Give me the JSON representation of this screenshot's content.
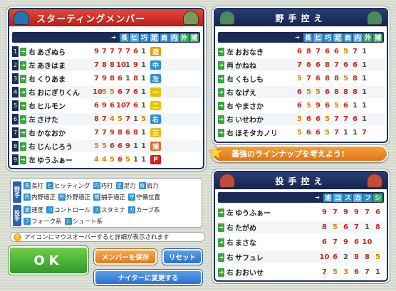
{
  "starting": {
    "title": "スターティングメンバー",
    "columns": [
      "長",
      "ヒ",
      "巧",
      "足",
      "肩",
      "内",
      "外",
      "捕"
    ],
    "rows": [
      {
        "n": "1",
        "hand": "右",
        "name": "あざぬら",
        "stats": [
          "9",
          "7",
          "7",
          "7",
          "7",
          "6",
          "1"
        ],
        "pos": "遊",
        "pc": "#e0a000"
      },
      {
        "n": "2",
        "hand": "左",
        "name": "あきはま",
        "stats": [
          "7",
          "8",
          "8",
          "10",
          "1",
          "9",
          "1"
        ],
        "pos": "中",
        "pc": "#2d8fd0"
      },
      {
        "n": "3",
        "hand": "右",
        "name": "くりあま",
        "stats": [
          "7",
          "9",
          "8",
          "6",
          "1",
          "8",
          "1"
        ],
        "pos": "左",
        "pc": "#2d8fd0"
      },
      {
        "n": "4",
        "hand": "右",
        "name": "おにぎりくん",
        "stats": [
          "10",
          "5",
          "5",
          "6",
          "7",
          "6",
          "1"
        ],
        "pos": "一",
        "pc": "#e8c400"
      },
      {
        "n": "5",
        "hand": "右",
        "name": "ヒルモン",
        "stats": [
          "6",
          "9",
          "6",
          "10",
          "7",
          "6",
          "1"
        ],
        "pos": "二",
        "pc": "#e8c400"
      },
      {
        "n": "6",
        "hand": "左",
        "name": "さけた",
        "stats": [
          "8",
          "7",
          "4",
          "5",
          "7",
          "1",
          "5"
        ],
        "pos": "右",
        "pc": "#2d8fd0"
      },
      {
        "n": "7",
        "hand": "右",
        "name": "かなおか",
        "stats": [
          "7",
          "7",
          "9",
          "8",
          "6",
          "8",
          "1"
        ],
        "pos": "三",
        "pc": "#e8c400"
      },
      {
        "n": "8",
        "hand": "右",
        "name": "じんじろう",
        "stats": [
          "5",
          "5",
          "6",
          "6",
          "9",
          "1",
          "1"
        ],
        "pos": "捕",
        "pc": "#e07020"
      },
      {
        "n": "9",
        "hand": "左",
        "name": "ゆうふぁー",
        "stats": [
          "4",
          "4",
          "5",
          "6",
          "5",
          "1",
          "1"
        ],
        "pos": "P",
        "pc": "#d02020"
      }
    ]
  },
  "bench": {
    "title": "野手控え",
    "columns": [
      "長",
      "ヒ",
      "巧",
      "足",
      "肩",
      "内",
      "外",
      "捕"
    ],
    "rows": [
      {
        "hand": "左",
        "name": "おおなき",
        "stats": [
          "6",
          "8",
          "7",
          "6",
          "6",
          "5",
          "7",
          "1"
        ]
      },
      {
        "hand": "両",
        "name": "かねね",
        "stats": [
          "7",
          "6",
          "6",
          "8",
          "7",
          "6",
          "6",
          "1"
        ]
      },
      {
        "hand": "右",
        "name": "くもしも",
        "stats": [
          "5",
          "7",
          "6",
          "8",
          "8",
          "5",
          "8",
          "1"
        ]
      },
      {
        "hand": "右",
        "name": "なげえ",
        "stats": [
          "6",
          "5",
          "5",
          "6",
          "8",
          "8",
          "8",
          "1"
        ]
      },
      {
        "hand": "右",
        "name": "やまさか",
        "stats": [
          "6",
          "5",
          "9",
          "6",
          "5",
          "6",
          "1",
          "1"
        ]
      },
      {
        "hand": "右",
        "name": "いせわか",
        "stats": [
          "5",
          "6",
          "6",
          "5",
          "7",
          "7",
          "6",
          "1"
        ]
      },
      {
        "hand": "右",
        "name": "ほそタカノリ",
        "stats": [
          "5",
          "6",
          "6",
          "5",
          "7",
          "1",
          "1",
          "7"
        ]
      }
    ]
  },
  "banner": {
    "text": "最強のラインナップを考えよう!"
  },
  "pitchers": {
    "title": "投手控え",
    "columns": [
      "速",
      "コ",
      "ス",
      "カ",
      "フ",
      "シ"
    ],
    "rows": [
      {
        "hand": "左",
        "name": "ゆうふぁー",
        "stats": [
          "9",
          "7",
          "9",
          "9",
          "7",
          "6"
        ]
      },
      {
        "hand": "右",
        "name": "たがめ",
        "stats": [
          "8",
          "5",
          "6",
          "7",
          "1",
          "8"
        ]
      },
      {
        "hand": "右",
        "name": "まさな",
        "stats": [
          "6",
          "7",
          "9",
          "6",
          "10",
          ""
        ]
      },
      {
        "hand": "右",
        "name": "サフュレ",
        "stats": [
          "10",
          "6",
          "2",
          "8",
          "8",
          "5"
        ]
      },
      {
        "hand": "右",
        "name": "おおいせ",
        "stats": [
          "7",
          "5",
          "3",
          "6",
          "7",
          "1"
        ]
      }
    ]
  },
  "legend": {
    "fielder_label": "野手",
    "pitcher_label": "投手",
    "fielder": [
      {
        "k": "長",
        "t": "長打",
        "c": "#2d8fd0"
      },
      {
        "k": "ヒ",
        "t": "ヒッティング",
        "c": "#2d8fd0"
      },
      {
        "k": "巧",
        "t": "巧打",
        "c": "#2d8fd0"
      },
      {
        "k": "足",
        "t": "足力",
        "c": "#2d8fd0"
      },
      {
        "k": "肩",
        "t": "肩力",
        "c": "#2d8fd0"
      },
      {
        "k": "内",
        "t": "内野適正",
        "c": "#2d8fd0"
      },
      {
        "k": "外",
        "t": "外野適正",
        "c": "#2d8fd0"
      },
      {
        "k": "捕",
        "t": "捕手適正",
        "c": "#2d8fd0"
      },
      {
        "k": "守",
        "t": "守備位置",
        "c": "#2d8fd0"
      }
    ],
    "pitcher": [
      {
        "k": "速",
        "t": "速度",
        "c": "#2d8fd0"
      },
      {
        "k": "コ",
        "t": "コントロール",
        "c": "#2d8fd0"
      },
      {
        "k": "ス",
        "t": "スタミナ",
        "c": "#2d8fd0"
      },
      {
        "k": "カ",
        "t": "カーブ系",
        "c": "#2d8fd0"
      },
      {
        "k": "フ",
        "t": "フォーク系",
        "c": "#2d8fd0"
      },
      {
        "k": "シ",
        "t": "シュート系",
        "c": "#2d8fd0"
      }
    ]
  },
  "note": {
    "icon": "!",
    "text": "アイコンにマウスオーバーすると詳細が表示されます"
  },
  "buttons": {
    "ok": "OK",
    "save": "メンバーを保存",
    "reset": "リセット",
    "nighter": "ナイターに変更する"
  },
  "colors": {
    "header_red": "#d8342a",
    "navy": "#1b2b55",
    "green": "#39a53a",
    "ok_green": "#3aa83a",
    "orange": "#f08a2a",
    "blue": "#2d6fd0"
  }
}
